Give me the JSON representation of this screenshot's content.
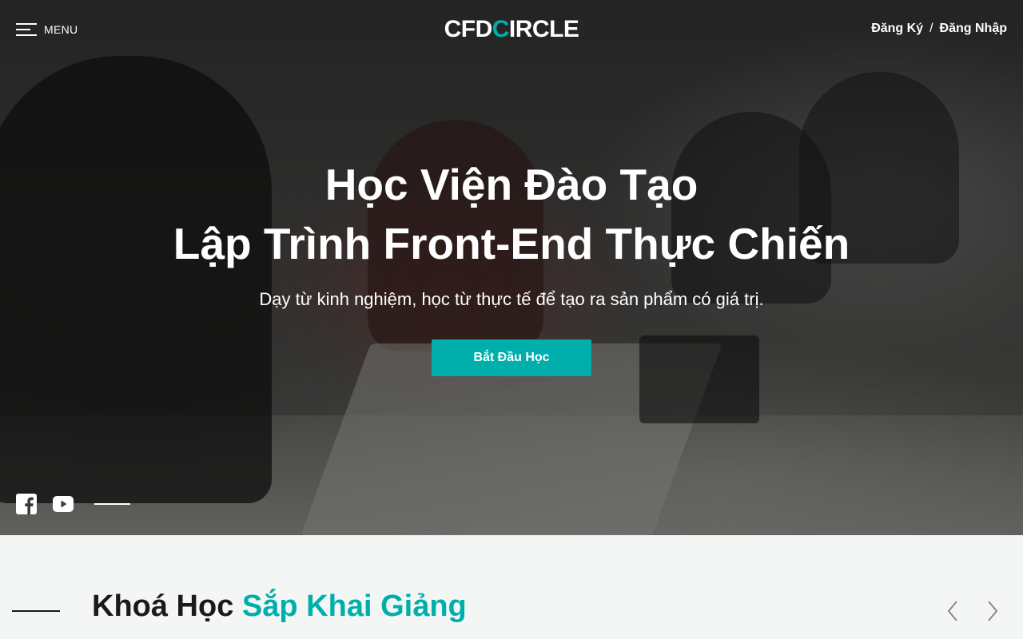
{
  "header": {
    "menu_label": "MENU",
    "logo_text_left": "CFD",
    "logo_text_right": "IRCLE",
    "logo_letter": "C",
    "register_label": "Đăng Ký",
    "separator": "/",
    "login_label": "Đăng Nhập"
  },
  "hero": {
    "title_line1": "Học Viện Đào Tạo",
    "title_line2": "Lập Trình Front-End Thực Chiến",
    "subtitle": "Dạy từ kinh nghiệm, học từ thực tế để tạo ra sản phẩm có giá trị.",
    "cta_label": "Bắt Đầu Học",
    "social": [
      "facebook-icon",
      "youtube-icon"
    ]
  },
  "section": {
    "title_plain": "Khoá Học",
    "title_accent": "Sắp Khai Giảng"
  },
  "colors": {
    "accent": "#00afab",
    "dark": "#1a1a1a",
    "section_bg": "#f4f6f5"
  }
}
